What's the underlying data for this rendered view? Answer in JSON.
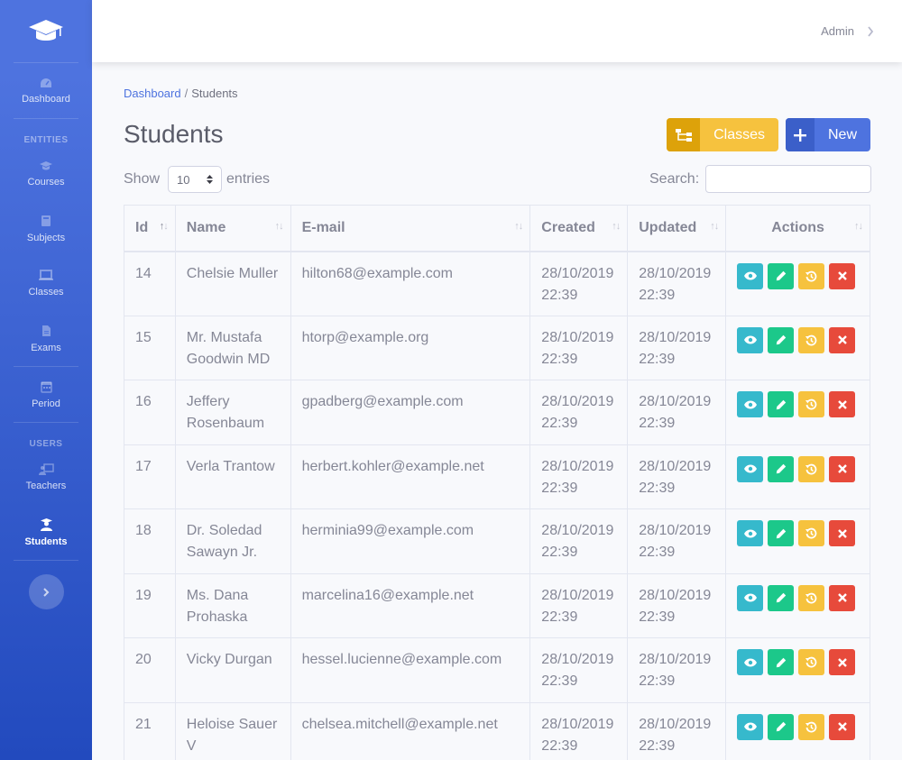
{
  "sidebar": {
    "brand_icon": "graduation-cap-icon",
    "items": [
      {
        "label": "Dashboard",
        "icon": "dashboard-icon"
      },
      {
        "label": "Courses",
        "icon": "graduation-cap-icon"
      },
      {
        "label": "Subjects",
        "icon": "book-icon"
      },
      {
        "label": "Classes",
        "icon": "laptop-icon"
      },
      {
        "label": "Exams",
        "icon": "file-icon"
      },
      {
        "label": "Period",
        "icon": "calendar-icon"
      },
      {
        "label": "Teachers",
        "icon": "chalkboard-teacher-icon"
      },
      {
        "label": "Students",
        "icon": "user-graduate-icon"
      }
    ],
    "headings": {
      "entities": "ENTITIES",
      "users": "USERS"
    }
  },
  "topbar": {
    "user": "Admin"
  },
  "breadcrumb": {
    "parent": "Dashboard",
    "separator": "/",
    "current": "Students"
  },
  "page": {
    "title": "Students"
  },
  "actions": {
    "classes_label": "Classes",
    "new_label": "New"
  },
  "controls": {
    "show_label": "Show",
    "entries_value": "10",
    "entries_label": "entries",
    "search_label": "Search:",
    "search_value": ""
  },
  "table": {
    "headers": [
      "Id",
      "Name",
      "E-mail",
      "Created",
      "Updated",
      "Actions"
    ],
    "rows": [
      {
        "id": "14",
        "name": "Chelsie Muller",
        "email": "hilton68@example.com",
        "created": "28/10/2019 22:39",
        "updated": "28/10/2019 22:39"
      },
      {
        "id": "15",
        "name": "Mr. Mustafa Goodwin MD",
        "email": "htorp@example.org",
        "created": "28/10/2019 22:39",
        "updated": "28/10/2019 22:39"
      },
      {
        "id": "16",
        "name": "Jeffery Rosenbaum",
        "email": "gpadberg@example.com",
        "created": "28/10/2019 22:39",
        "updated": "28/10/2019 22:39"
      },
      {
        "id": "17",
        "name": "Verla Trantow",
        "email": "herbert.kohler@example.net",
        "created": "28/10/2019 22:39",
        "updated": "28/10/2019 22:39"
      },
      {
        "id": "18",
        "name": "Dr. Soledad Sawayn Jr.",
        "email": "herminia99@example.com",
        "created": "28/10/2019 22:39",
        "updated": "28/10/2019 22:39"
      },
      {
        "id": "19",
        "name": "Ms. Dana Prohaska",
        "email": "marcelina16@example.net",
        "created": "28/10/2019 22:39",
        "updated": "28/10/2019 22:39"
      },
      {
        "id": "20",
        "name": "Vicky Durgan",
        "email": "hessel.lucienne@example.com",
        "created": "28/10/2019 22:39",
        "updated": "28/10/2019 22:39"
      },
      {
        "id": "21",
        "name": "Heloise Sauer V",
        "email": "chelsea.mitchell@example.net",
        "created": "28/10/2019 22:39",
        "updated": "28/10/2019 22:39"
      }
    ]
  },
  "colors": {
    "primary": "#4e73df",
    "info": "#36b9cc",
    "success": "#1cc88a",
    "warning": "#f6c23e",
    "danger": "#e74a3b"
  }
}
